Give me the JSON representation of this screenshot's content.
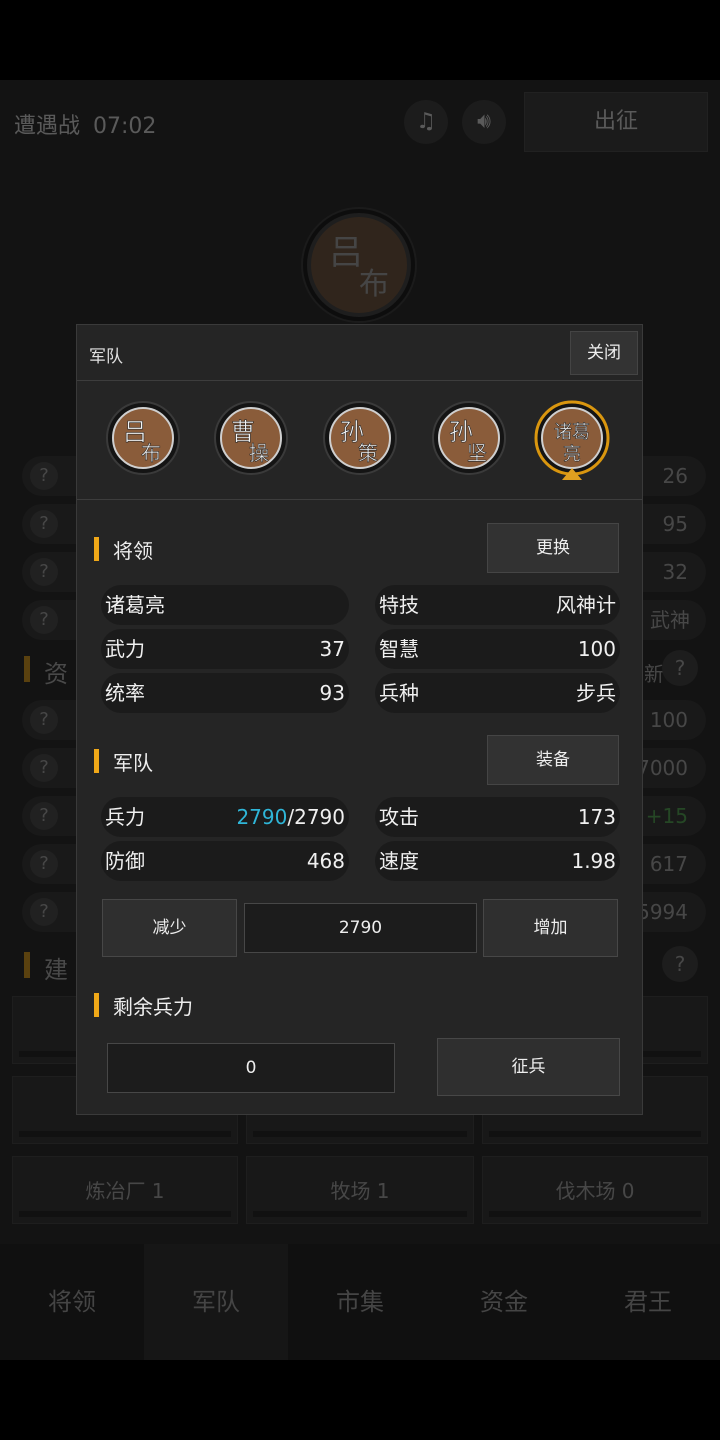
{
  "background": {
    "battle_title": "遭遇战",
    "timer": "07:02",
    "music_icon": "music-note-icon",
    "sound_icon": "speaker-icon",
    "deploy_label": "出征",
    "top_general": "吕布",
    "stat_values": [
      "26",
      "95",
      "32",
      "武神"
    ],
    "resource_section_title": "资",
    "resource_right_text": "新",
    "resource_values": [
      "100",
      "7000",
      "+15",
      "617",
      "5994"
    ],
    "building_section_title": "建",
    "buildings": [
      {
        "label": "",
        "row": 1
      },
      {
        "label": "",
        "row": 1
      },
      {
        "label": "",
        "row": 1
      },
      {
        "label": "",
        "row": 2
      },
      {
        "label": "",
        "row": 2
      },
      {
        "label": "",
        "row": 2
      },
      {
        "label": "炼冶厂 1",
        "row": 3
      },
      {
        "label": "牧场 1",
        "row": 3
      },
      {
        "label": "伐木场 0",
        "row": 3
      }
    ],
    "nav": [
      "将领",
      "军队",
      "市集",
      "资金",
      "君王"
    ]
  },
  "dialog": {
    "title": "军队",
    "close_label": "关闭",
    "generals": [
      {
        "name_top": "吕",
        "name_bottom": "布",
        "selected": false
      },
      {
        "name_top": "曹",
        "name_bottom": "操",
        "selected": false
      },
      {
        "name_top": "孙",
        "name_bottom": "策",
        "selected": false
      },
      {
        "name_top": "孙",
        "name_bottom": "坚",
        "selected": false
      },
      {
        "name_top": "诸葛",
        "name_bottom": "亮",
        "selected": true
      }
    ],
    "general_section": {
      "title": "将领",
      "change_label": "更换",
      "name": "诸葛亮",
      "skill_label": "特技",
      "skill_value": "风神计",
      "force_label": "武力",
      "force_value": "37",
      "wisdom_label": "智慧",
      "wisdom_value": "100",
      "command_label": "统率",
      "command_value": "93",
      "troop_type_label": "兵种",
      "troop_type_value": "步兵"
    },
    "army_section": {
      "title": "军队",
      "equip_label": "装备",
      "troops_label": "兵力",
      "troops_current": "2790",
      "troops_max": "/2790",
      "attack_label": "攻击",
      "attack_value": "173",
      "defense_label": "防御",
      "defense_value": "468",
      "speed_label": "速度",
      "speed_value": "1.98",
      "decrease_label": "减少",
      "amount_value": "2790",
      "increase_label": "增加"
    },
    "remaining_section": {
      "title": "剩余兵力",
      "remaining_value": "0",
      "recruit_label": "征兵"
    }
  }
}
